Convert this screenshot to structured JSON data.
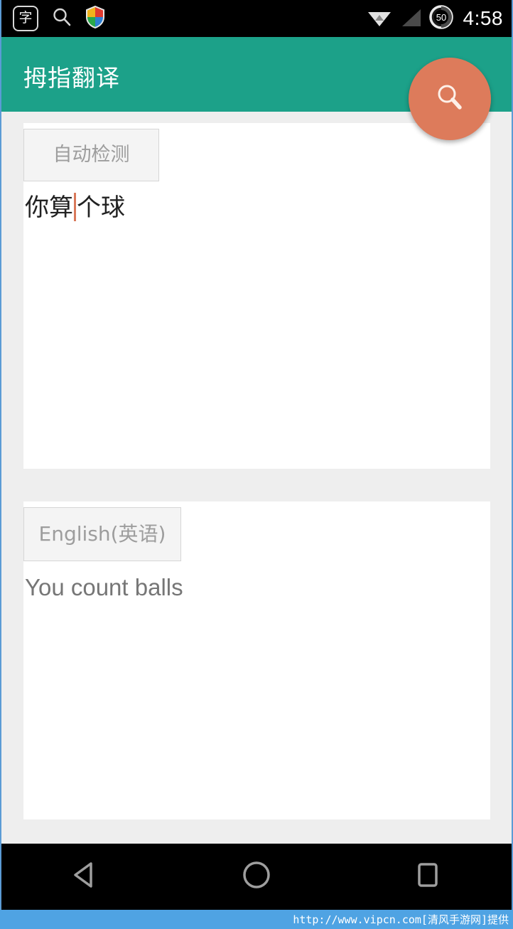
{
  "status_bar": {
    "left_icons": [
      {
        "name": "chinese-character-app-icon",
        "glyph": "字"
      },
      {
        "name": "search-notification-icon",
        "glyph": "search"
      },
      {
        "name": "security-shield-icon",
        "glyph": "shield"
      }
    ],
    "wifi_icon": "wifi-icon",
    "signal_icon": "signal-bars-icon",
    "battery_level": "50",
    "time": "4:58",
    "background_color": "#000000"
  },
  "app_bar": {
    "title": "拇指翻译",
    "background_color": "#1ca189",
    "text_color": "#ffffff"
  },
  "fab": {
    "icon": "search-icon",
    "color": "#dd7b5b"
  },
  "source_panel": {
    "language_label": "自动检测",
    "text_before_caret": "你算",
    "text_after_caret": "个球",
    "full_text": "你算个球"
  },
  "target_panel": {
    "language_label": "English(英语)",
    "text": "You count balls"
  },
  "nav_bar": {
    "back_label": "back-button",
    "home_label": "home-button",
    "recents_label": "recents-button",
    "background_color": "#000000"
  },
  "watermark": {
    "text": "http://www.vipcn.com[清风手游网]提供",
    "background_color": "#4fa3e3"
  }
}
